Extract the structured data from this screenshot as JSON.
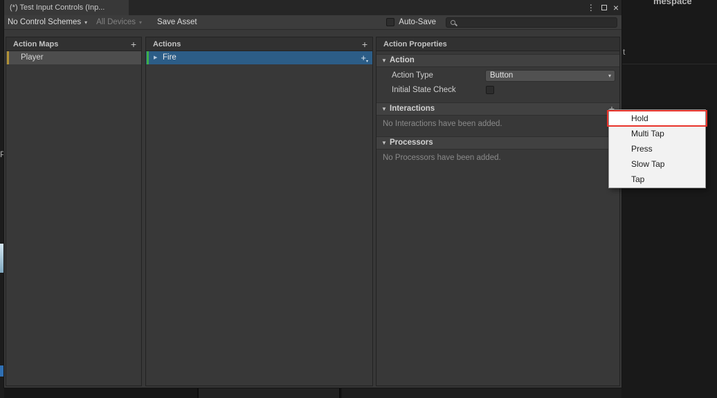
{
  "window": {
    "tab_title": "(*) Test Input Controls (Inp..."
  },
  "icons": {
    "kebab": "⋮",
    "close": "×",
    "dropdown_arrow": "▾",
    "foldout_open": "▼",
    "foldout_closed": "▶",
    "plus": "+"
  },
  "toolbar": {
    "control_schemes": "No Control Schemes",
    "devices": "All Devices",
    "save_asset": "Save Asset",
    "auto_save_label": "Auto-Save",
    "search_value": ""
  },
  "panels": {
    "action_maps": {
      "header": "Action Maps",
      "items": [
        {
          "label": "Player",
          "selected": true
        }
      ]
    },
    "actions": {
      "header": "Actions",
      "items": [
        {
          "label": "Fire",
          "selected": true
        }
      ]
    },
    "properties": {
      "header": "Action Properties",
      "action_section": {
        "title": "Action",
        "action_type_label": "Action Type",
        "action_type_value": "Button",
        "initial_state_label": "Initial State Check",
        "initial_state_checked": false
      },
      "interactions_section": {
        "title": "Interactions",
        "empty_text": "No Interactions have been added."
      },
      "processors_section": {
        "title": "Processors",
        "empty_text": "No Processors have been added."
      }
    }
  },
  "context_menu": {
    "items": [
      {
        "label": "Hold",
        "highlighted": true
      },
      {
        "label": "Multi Tap"
      },
      {
        "label": "Press"
      },
      {
        "label": "Slow Tap"
      },
      {
        "label": "Tap"
      }
    ]
  },
  "background_fragments": {
    "top_right": "mespace",
    "right_edge": "t",
    "left_edge": "P"
  },
  "colors": {
    "selection_blue": "#2c5d87",
    "selection_gray": "#4d4d4d",
    "accent_green": "#3fae46",
    "accent_yellow": "#b29236",
    "menu_highlight_border": "#e8332a"
  }
}
